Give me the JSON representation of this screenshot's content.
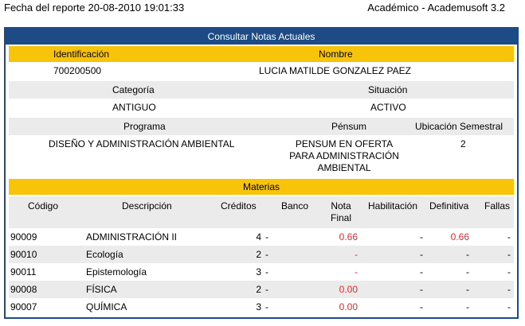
{
  "header": {
    "report_date": "Fecha del reporte 20-08-2010 19:01:33",
    "app": "Académico - Academusoft 3.2"
  },
  "title": "Consultar Notas Actuales",
  "student": {
    "id_label": "Identificación",
    "name_label": "Nombre",
    "id_value": "700200500",
    "name_value": "LUCIA MATILDE GONZALEZ PAEZ",
    "category_label": "Categoría",
    "situation_label": "Situación",
    "category_value": "ANTIGUO",
    "situation_value": "ACTIVO",
    "program_label": "Programa",
    "pensum_label": "Pénsum",
    "semester_label": "Ubicación Semestral",
    "program_value": "DISEÑO Y ADMINISTRACIÓN AMBIENTAL",
    "pensum_line1": "PENSUM EN OFERTA",
    "pensum_line2": "PARA ADMINISTRACIÓN",
    "pensum_line3": "AMBIENTAL",
    "semester_value": "2"
  },
  "materias": {
    "title": "Materias",
    "columns": {
      "code": "Código",
      "desc": "Descripción",
      "credits": "Créditos",
      "bank": "Banco",
      "nota1": "Nota",
      "nota2": "Final",
      "habil": "Habilitación",
      "def": "Definitiva",
      "fallas": "Fallas"
    },
    "rows": [
      {
        "code": "90009",
        "desc": "ADMINISTRACIÓN II",
        "credits": "4",
        "bank": "-",
        "nota": "0.66",
        "habil": "-",
        "def": "0.66",
        "fallas": "-"
      },
      {
        "code": "90010",
        "desc": "Ecología",
        "credits": "2",
        "bank": "-",
        "nota": "-",
        "habil": "-",
        "def": "-",
        "fallas": "-"
      },
      {
        "code": "90011",
        "desc": "Epistemología",
        "credits": "3",
        "bank": "-",
        "nota": "-",
        "habil": "-",
        "def": "-",
        "fallas": "-"
      },
      {
        "code": "90008",
        "desc": "FÍSICA",
        "credits": "2",
        "bank": "-",
        "nota": "0.00",
        "habil": "-",
        "def": "-",
        "fallas": "-"
      },
      {
        "code": "90007",
        "desc": "QUÍMICA",
        "credits": "3",
        "bank": "-",
        "nota": "0.00",
        "habil": "-",
        "def": "-",
        "fallas": "-"
      }
    ]
  },
  "colors": {
    "accent": "#1d4b85",
    "gold": "#f8c409",
    "grey": "#ebebeb",
    "red": "#e8282b"
  }
}
